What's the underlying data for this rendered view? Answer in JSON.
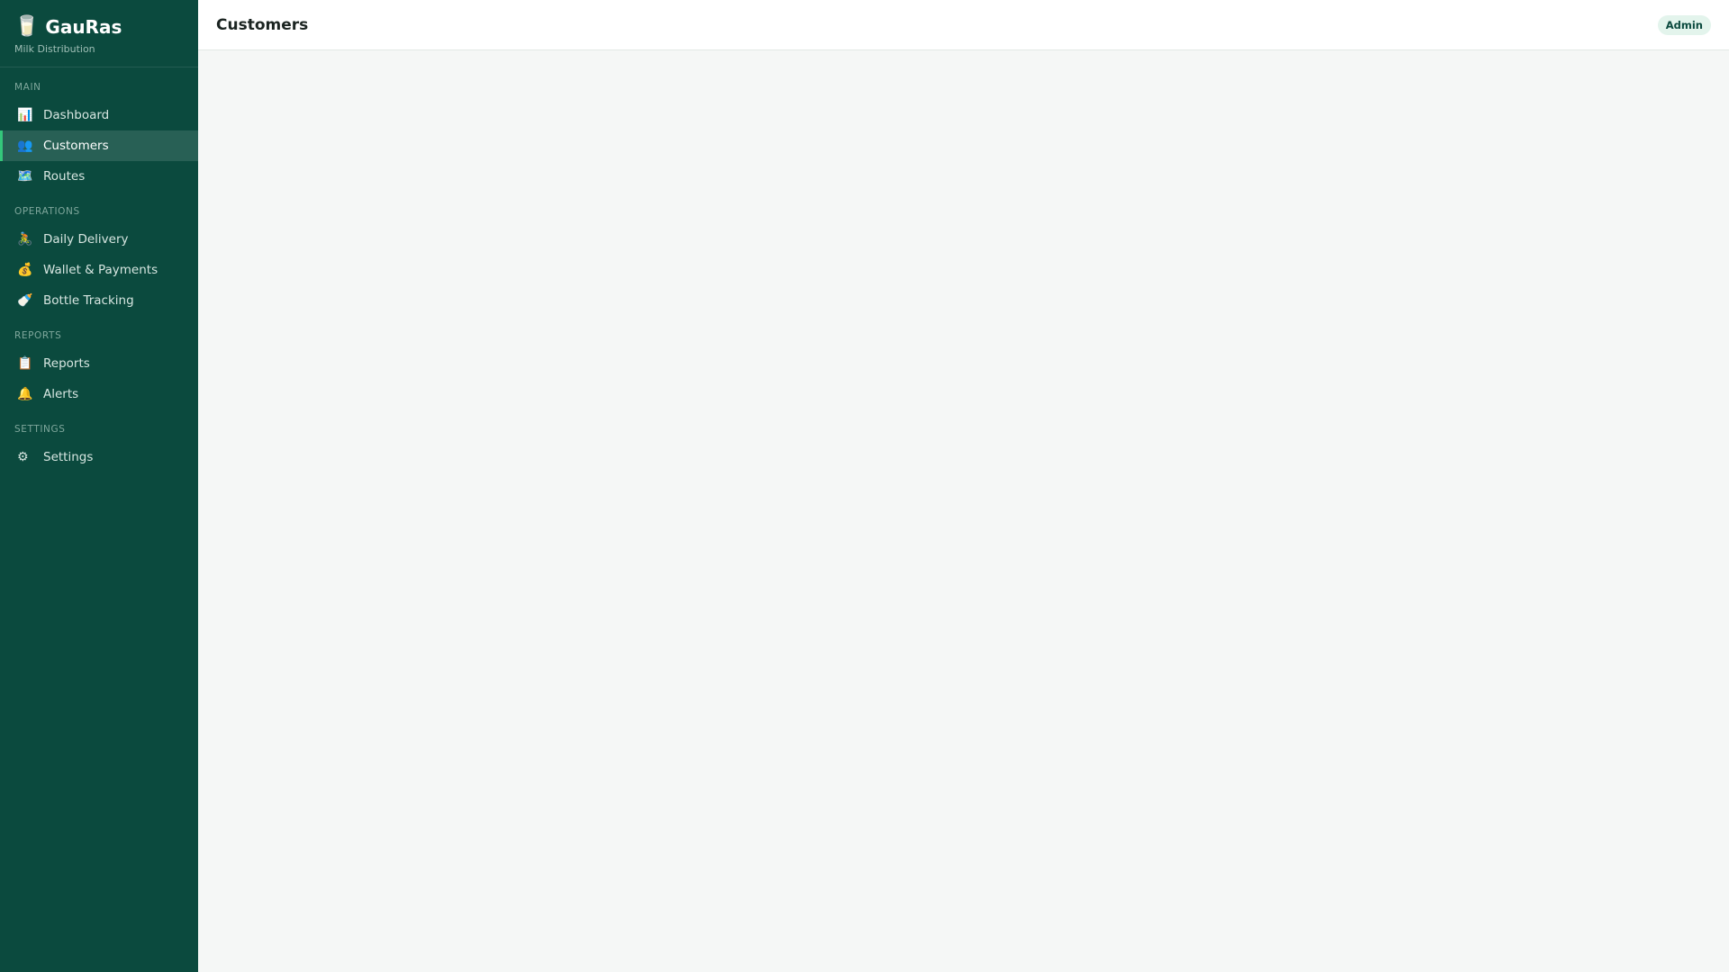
{
  "brand": {
    "icon": "milk-glass-icon",
    "name": "GauRas",
    "subtitle": "Milk Distribution"
  },
  "sidebar": {
    "sections": [
      {
        "title": "MAIN",
        "items": [
          {
            "icon": "📊",
            "label": "Dashboard"
          },
          {
            "icon": "👥",
            "label": "Customers",
            "active": true
          },
          {
            "icon": "🗺️",
            "label": "Routes"
          }
        ]
      },
      {
        "title": "OPERATIONS",
        "items": [
          {
            "icon": "🚴",
            "label": "Daily Delivery"
          },
          {
            "icon": "💰",
            "label": "Wallet & Payments"
          },
          {
            "icon": "🍼",
            "label": "Bottle Tracking"
          }
        ]
      },
      {
        "title": "REPORTS",
        "items": [
          {
            "icon": "📋",
            "label": "Reports"
          },
          {
            "icon": "🔔",
            "label": "Alerts"
          }
        ]
      },
      {
        "title": "SETTINGS",
        "items": [
          {
            "icon": "⚙",
            "label": "Settings"
          }
        ]
      }
    ]
  },
  "header": {
    "title": "Customers",
    "role_badge": "Admin"
  },
  "colors": {
    "sidebar_bg": "#0b4a3e",
    "active_accent": "#34c77b",
    "content_bg": "#f5f7f6"
  }
}
